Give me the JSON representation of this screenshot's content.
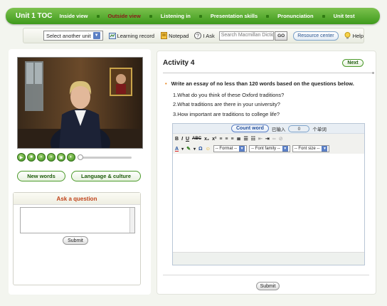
{
  "nav": {
    "unit_title": "Unit 1 TOC",
    "items": [
      {
        "label": "Inside view",
        "active": false
      },
      {
        "label": "Outside view",
        "active": true
      },
      {
        "label": "Listening in",
        "active": false
      },
      {
        "label": "Presentation skills",
        "active": false
      },
      {
        "label": "Pronunciation",
        "active": false
      },
      {
        "label": "Unit test",
        "active": false
      }
    ]
  },
  "toolbar": {
    "unit_select": "Select another unit",
    "learning_record": "Learning record",
    "notepad": "Notepad",
    "ask": "I Ask",
    "search_placeholder": "Search Macmillan Dictionary",
    "go": "GO",
    "resource_center": "Resource center",
    "help": "Help"
  },
  "left": {
    "new_words": "New words",
    "language_culture": "Language & culture",
    "ask_title": "Ask a question",
    "submit": "Submit"
  },
  "activity": {
    "title": "Activity 4",
    "next": "Next",
    "instruction": "Write an essay of no less than 120 words based on the questions below.",
    "questions": [
      "1.What do you think of these Oxford traditions?",
      "2.What traditions are there in your university?",
      "3.How important are traditions to college life?"
    ],
    "count_word": "Count word",
    "entered_label": "已输入",
    "word_count": "0",
    "word_unit": "个单词",
    "format_label": "-- Format --",
    "font_family_label": "-- Font family --",
    "font_size_label": "-- Font size --",
    "submit": "Submit"
  },
  "colors": {
    "nav_green": "#3e9a1c",
    "active_nav": "#8b1a1a",
    "ask_title": "#c0431a"
  }
}
